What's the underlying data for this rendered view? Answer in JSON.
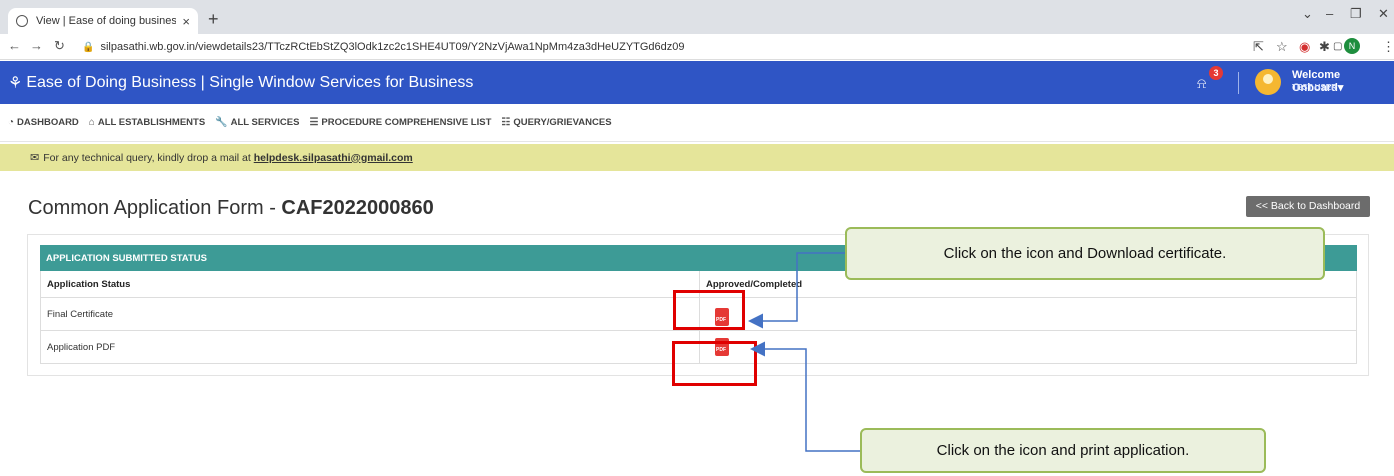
{
  "browser": {
    "tab_title": "View | Ease of doing business",
    "tab_close": "×",
    "new_tab": "+",
    "url": "silpasathi.wb.gov.in/viewdetails23/TTczRCtEbStZQ3lOdk1zc2c1SHE4UT09/Y2NzVjAwa1NpMm4za3dHeUZYTGd6dz09",
    "profile_initial": "N"
  },
  "header": {
    "brand": "Ease of Doing Business | Single Window Services for Business",
    "notification_count": "3",
    "welcome": "Welcome Onboard",
    "user": "TEST USER"
  },
  "menu": {
    "items": [
      {
        "label": "DASHBOARD",
        "icon": "dashboard-icon"
      },
      {
        "label": "ALL ESTABLISHMENTS",
        "icon": "building-icon"
      },
      {
        "label": "ALL SERVICES",
        "icon": "wrench-icon"
      },
      {
        "label": "PROCEDURE COMPREHENSIVE LIST",
        "icon": "list-icon"
      },
      {
        "label": "QUERY/GRIEVANCES",
        "icon": "query-icon"
      }
    ]
  },
  "notice": {
    "text": "For any technical query, kindly drop a mail at ",
    "email": "helpdesk.silpasathi@gmail.com"
  },
  "page": {
    "title_prefix": "Common Application Form - ",
    "caf_number": "CAF2022000860",
    "back_button": "<< Back to Dashboard"
  },
  "table": {
    "section_title": "APPLICATION SUBMITTED STATUS",
    "col1": "Application Status",
    "col2": "Approved/Completed",
    "rows": [
      {
        "label": "Final Certificate",
        "icon": "pdf-icon"
      },
      {
        "label": "Application PDF",
        "icon": "pdf-icon"
      }
    ],
    "pdf_icon_text": "PDF"
  },
  "annotations": {
    "callout1": "Click on the icon and Download certificate.",
    "callout2": "Click on the icon and print application."
  },
  "colors": {
    "header_blue": "#2f55c5",
    "table_teal": "#3d9b96",
    "notice_yellow": "#e5e59a",
    "callout_fill": "#ebf1de",
    "callout_border": "#9bbb59",
    "arrow_blue": "#4472c4",
    "highlight_red": "#e00000"
  }
}
